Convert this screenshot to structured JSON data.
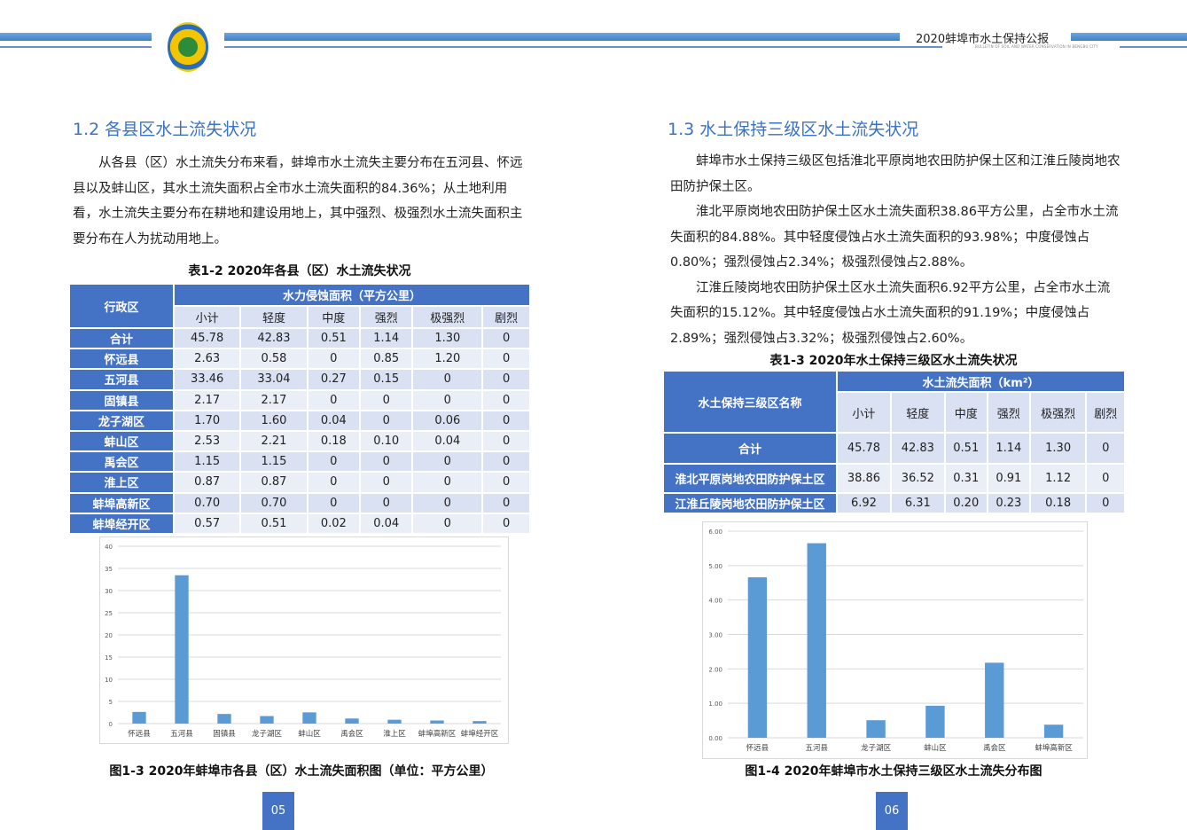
{
  "header": {
    "title": "2020蚌埠市水土保持公报",
    "subtitle": "BULLETIN OF SOIL AND WATER CONSERVATION IN BENGBU CITY"
  },
  "left": {
    "section_title": "1.2 各县区水土流失状况",
    "paragraph": "从各县（区）水土流失分布来看，蚌埠市水土流失主要分布在五河县、怀远县以及蚌山区，其水土流失面积占全市水土流失面积的84.36%；从土地利用看，水土流失主要分布在耕地和建设用地上，其中强烈、极强烈水土流失面积主要分布在人为扰动用地上。",
    "table_caption": "表1-2 2020年各县（区）水土流失状况",
    "table": {
      "corner": "行政区",
      "group": "水力侵蚀面积（平方公里）",
      "columns": [
        "小计",
        "轻度",
        "中度",
        "强烈",
        "极强烈",
        "剧烈"
      ],
      "rows": [
        [
          "合计",
          "45.78",
          "42.83",
          "0.51",
          "1.14",
          "1.30",
          "0"
        ],
        [
          "怀远县",
          "2.63",
          "0.58",
          "0",
          "0.85",
          "1.20",
          "0"
        ],
        [
          "五河县",
          "33.46",
          "33.04",
          "0.27",
          "0.15",
          "0",
          "0"
        ],
        [
          "固镇县",
          "2.17",
          "2.17",
          "0",
          "0",
          "0",
          "0"
        ],
        [
          "龙子湖区",
          "1.70",
          "1.60",
          "0.04",
          "0",
          "0.06",
          "0"
        ],
        [
          "蚌山区",
          "2.53",
          "2.21",
          "0.18",
          "0.10",
          "0.04",
          "0"
        ],
        [
          "禹会区",
          "1.15",
          "1.15",
          "0",
          "0",
          "0",
          "0"
        ],
        [
          "淮上区",
          "0.87",
          "0.87",
          "0",
          "0",
          "0",
          "0"
        ],
        [
          "蚌埠高新区",
          "0.70",
          "0.70",
          "0",
          "0",
          "0",
          "0"
        ],
        [
          "蚌埠经开区",
          "0.57",
          "0.51",
          "0.02",
          "0.04",
          "0",
          "0"
        ]
      ]
    },
    "figure_caption": "图1-3 2020年蚌埠市各县（区）水土流失面积图（单位：平方公里）",
    "page_number": "05"
  },
  "right": {
    "section_title": "1.3 水土保持三级区水土流失状况",
    "paragraphs": [
      "蚌埠市水土保持三级区包括淮北平原岗地农田防护保土区和江淮丘陵岗地农田防护保土区。",
      "淮北平原岗地农田防护保土区水土流失面积38.86平方公里，占全市水土流失面积的84.88%。其中轻度侵蚀占水土流失面积的93.98%；中度侵蚀占0.80%；强烈侵蚀占2.34%；极强烈侵蚀占2.88%。",
      "江淮丘陵岗地农田防护保土区水土流失面积6.92平方公里，占全市水土流失面积的15.12%。其中轻度侵蚀占水土流失面积的91.19%；中度侵蚀占2.89%；强烈侵蚀占3.32%；极强烈侵蚀占2.60%。"
    ],
    "table_caption": "表1-3   2020年水土保持三级区水土流失状况",
    "table": {
      "corner": "水土保持三级区名称",
      "group": "水土流失面积（km²）",
      "columns": [
        "小计",
        "轻度",
        "中度",
        "强烈",
        "极强烈",
        "剧烈"
      ],
      "rows": [
        [
          "合计",
          "45.78",
          "42.83",
          "0.51",
          "1.14",
          "1.30",
          "0"
        ],
        [
          "淮北平原岗地农田防护保土区",
          "38.86",
          "36.52",
          "0.31",
          "0.91",
          "1.12",
          "0"
        ],
        [
          "江淮丘陵岗地农田防护保土区",
          "6.92",
          "6.31",
          "0.20",
          "0.23",
          "0.18",
          "0"
        ]
      ]
    },
    "figure_caption": "图1-4 2020年蚌埠市水土保持三级区水土流失分布图",
    "page_number": "06"
  },
  "chart_data": [
    {
      "type": "bar",
      "title": "",
      "categories": [
        "怀远县",
        "五河县",
        "固镇县",
        "龙子湖区",
        "蚌山区",
        "禹会区",
        "淮上区",
        "蚌埠高新区",
        "蚌埠经开区"
      ],
      "values": [
        2.63,
        33.46,
        2.17,
        1.7,
        2.53,
        1.15,
        0.87,
        0.7,
        0.57
      ],
      "ylim": [
        0,
        40
      ],
      "yticks": [
        "0",
        "5",
        "10",
        "15",
        "20",
        "25",
        "30",
        "35",
        "40"
      ],
      "grid": true,
      "color": "#5b9bd5"
    },
    {
      "type": "bar",
      "title": "",
      "categories": [
        "怀远县",
        "五河县",
        "龙子湖区",
        "蚌山区",
        "禹会区",
        "蚌埠高新区"
      ],
      "values": [
        4.66,
        5.65,
        0.51,
        0.93,
        2.18,
        0.38
      ],
      "ylim": [
        0,
        6
      ],
      "yticks": [
        "0.00",
        "1.00",
        "2.00",
        "3.00",
        "4.00",
        "5.00",
        "6.00"
      ],
      "grid": true,
      "color": "#5b9bd5"
    }
  ]
}
